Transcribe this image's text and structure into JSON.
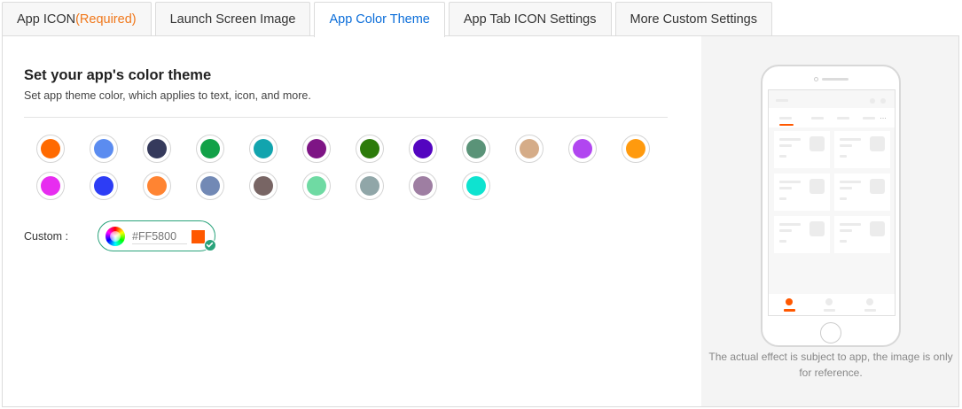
{
  "tabs": [
    {
      "label": "App ICON",
      "required": "(Required)",
      "active": false
    },
    {
      "label": "Launch Screen Image",
      "active": false
    },
    {
      "label": "App Color Theme",
      "active": true
    },
    {
      "label": "App Tab ICON Settings",
      "active": false
    },
    {
      "label": "More Custom Settings",
      "active": false
    }
  ],
  "section": {
    "title": "Set your app's color theme",
    "subtitle": "Set app theme color, which applies to text, icon, and more."
  },
  "colors": {
    "row1": [
      "#FF6A00",
      "#5B8CF0",
      "#353A5C",
      "#12A148",
      "#12A4AE",
      "#7E1585",
      "#2C7B0A",
      "#5305C0",
      "#5A9378",
      "#D5AC88",
      "#B146F0",
      "#FF9A0E"
    ],
    "row2": [
      "#E72DF0",
      "#2D3DF5",
      "#FF8432",
      "#7289B5",
      "#786564",
      "#6FDAA3",
      "#90A6A8",
      "#9E7EA2",
      "#0EE3D0"
    ],
    "accent": "#2AA37B",
    "selected": "#FF5800"
  },
  "custom": {
    "label": "Custom :",
    "hex_placeholder": "#FF5800"
  },
  "preview": {
    "caption": "The actual effect is subject to app, the image is only for reference.",
    "tab_icon_active_color": "#FF5800"
  }
}
